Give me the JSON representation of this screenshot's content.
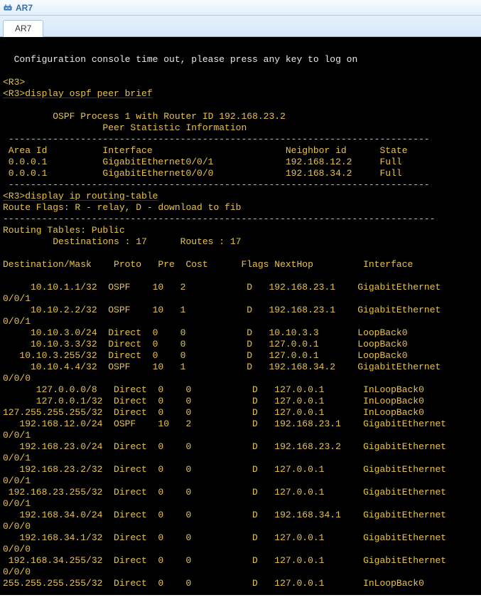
{
  "titlebar": {
    "icon_label": "router-icon",
    "title": "AR7"
  },
  "tabs": [
    {
      "label": "AR7"
    }
  ],
  "terminal": {
    "router_prompt": "<R3>",
    "timeout_msg": "  Configuration console time out, please press any key to log on",
    "cmd1": "<R3>display ospf peer brief",
    "ospf_header1": "\t OSPF Process 1 with Router ID 192.168.23.2",
    "ospf_header2": "\t\t  Peer Statistic Information",
    "dashline": " ----------------------------------------------------------------------------",
    "peer_header": " Area Id          Interface                        Neighbor id      State",
    "peers": [
      " 0.0.0.1          GigabitEthernet0/0/1             192.168.12.2     Full",
      " 0.0.0.1          GigabitEthernet0/0/0             192.168.34.2     Full"
    ],
    "cmd2": "<R3>display ip routing-table",
    "route_flags": "Route Flags: R - relay, D - download to fib",
    "dashline2": "------------------------------------------------------------------------------",
    "routing_tables": "Routing Tables: Public",
    "dest_routes": "         Destinations : 17\tRoutes : 17",
    "route_header": "Destination/Mask    Proto   Pre  Cost      Flags NextHop         Interface",
    "routes": [
      {
        "l1": "     10.10.1.1/32  OSPF    10   2           D   192.168.23.1    GigabitEthernet",
        "l2": "0/0/1"
      },
      {
        "l1": "     10.10.2.2/32  OSPF    10   1           D   192.168.23.1    GigabitEthernet",
        "l2": "0/0/1"
      },
      {
        "l1": "     10.10.3.0/24  Direct  0    0           D   10.10.3.3       LoopBack0",
        "l2": ""
      },
      {
        "l1": "     10.10.3.3/32  Direct  0    0           D   127.0.0.1       LoopBack0",
        "l2": ""
      },
      {
        "l1": "   10.10.3.255/32  Direct  0    0           D   127.0.0.1       LoopBack0",
        "l2": ""
      },
      {
        "l1": "     10.10.4.4/32  OSPF    10   1           D   192.168.34.2    GigabitEthernet",
        "l2": "0/0/0"
      },
      {
        "l1": "      127.0.0.0/8   Direct  0    0           D   127.0.0.1       InLoopBack0",
        "l2": ""
      },
      {
        "l1": "      127.0.0.1/32  Direct  0    0           D   127.0.0.1       InLoopBack0",
        "l2": ""
      },
      {
        "l1": "127.255.255.255/32  Direct  0    0           D   127.0.0.1       InLoopBack0",
        "l2": ""
      },
      {
        "l1": "   192.168.12.0/24  OSPF    10   2           D   192.168.23.1    GigabitEthernet",
        "l2": "0/0/1"
      },
      {
        "l1": "   192.168.23.0/24  Direct  0    0           D   192.168.23.2    GigabitEthernet",
        "l2": "0/0/1"
      },
      {
        "l1": "   192.168.23.2/32  Direct  0    0           D   127.0.0.1       GigabitEthernet",
        "l2": "0/0/1"
      },
      {
        "l1": " 192.168.23.255/32  Direct  0    0           D   127.0.0.1       GigabitEthernet",
        "l2": "0/0/1"
      },
      {
        "l1": "   192.168.34.0/24  Direct  0    0           D   192.168.34.1    GigabitEthernet",
        "l2": "0/0/0"
      },
      {
        "l1": "   192.168.34.1/32  Direct  0    0           D   127.0.0.1       GigabitEthernet",
        "l2": "0/0/0"
      },
      {
        "l1": " 192.168.34.255/32  Direct  0    0           D   127.0.0.1       GigabitEthernet",
        "l2": "0/0/0"
      },
      {
        "l1": "255.255.255.255/32  Direct  0    0           D   127.0.0.1       InLoopBack0",
        "l2": ""
      }
    ]
  }
}
